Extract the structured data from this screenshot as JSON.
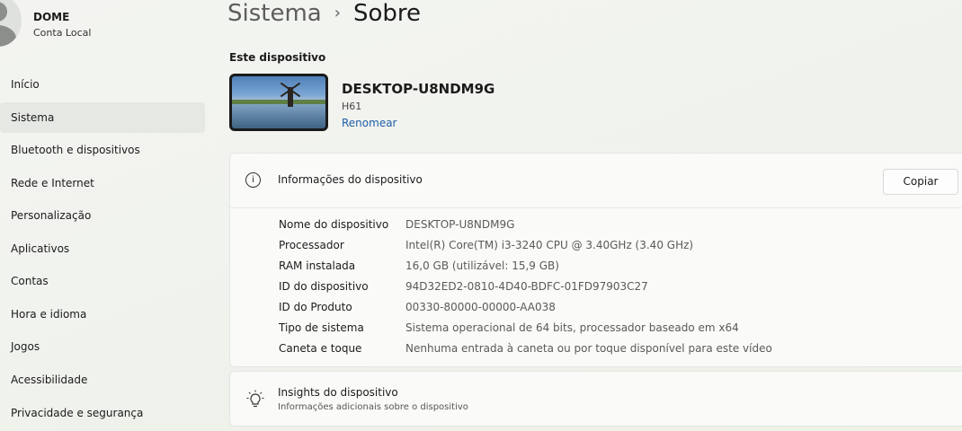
{
  "user": {
    "name": "DOME",
    "account_type": "Conta Local"
  },
  "sidebar": {
    "items": [
      {
        "label": "Início",
        "active": false
      },
      {
        "label": "Sistema",
        "active": true
      },
      {
        "label": "Bluetooth e dispositivos",
        "active": false
      },
      {
        "label": "Rede e Internet",
        "active": false
      },
      {
        "label": "Personalização",
        "active": false
      },
      {
        "label": "Aplicativos",
        "active": false
      },
      {
        "label": "Contas",
        "active": false
      },
      {
        "label": "Hora e idioma",
        "active": false
      },
      {
        "label": "Jogos",
        "active": false
      },
      {
        "label": "Acessibilidade",
        "active": false
      },
      {
        "label": "Privacidade e segurança",
        "active": false
      }
    ]
  },
  "breadcrumb": {
    "parent": "Sistema",
    "separator": "›",
    "current": "Sobre"
  },
  "device": {
    "section_title": "Este dispositivo",
    "name": "DESKTOP-U8NDM9G",
    "model": "H61",
    "rename_label": "Renomear"
  },
  "device_info": {
    "title": "Informações do dispositivo",
    "copy_label": "Copiar",
    "specs": [
      {
        "label": "Nome do dispositivo",
        "value": "DESKTOP-U8NDM9G"
      },
      {
        "label": "Processador",
        "value": "Intel(R) Core(TM) i3-3240 CPU @ 3.40GHz (3.40 GHz)"
      },
      {
        "label": "RAM instalada",
        "value": "16,0 GB (utilizável: 15,9 GB)"
      },
      {
        "label": "ID do dispositivo",
        "value": "94D32ED2-0810-4D40-BDFC-01FD97903C27"
      },
      {
        "label": "ID do Produto",
        "value": "00330-80000-00000-AA038"
      },
      {
        "label": "Tipo de sistema",
        "value": "Sistema operacional de 64 bits, processador baseado em x64"
      },
      {
        "label": "Caneta e toque",
        "value": "Nenhuma entrada à caneta ou por toque disponível para este vídeo"
      }
    ]
  },
  "insights": {
    "title": "Insights do dispositivo",
    "subtitle": "Informações adicionais sobre o dispositivo"
  },
  "colors": {
    "link": "#1d5ea8",
    "active_nav": "#e6e8e4"
  }
}
